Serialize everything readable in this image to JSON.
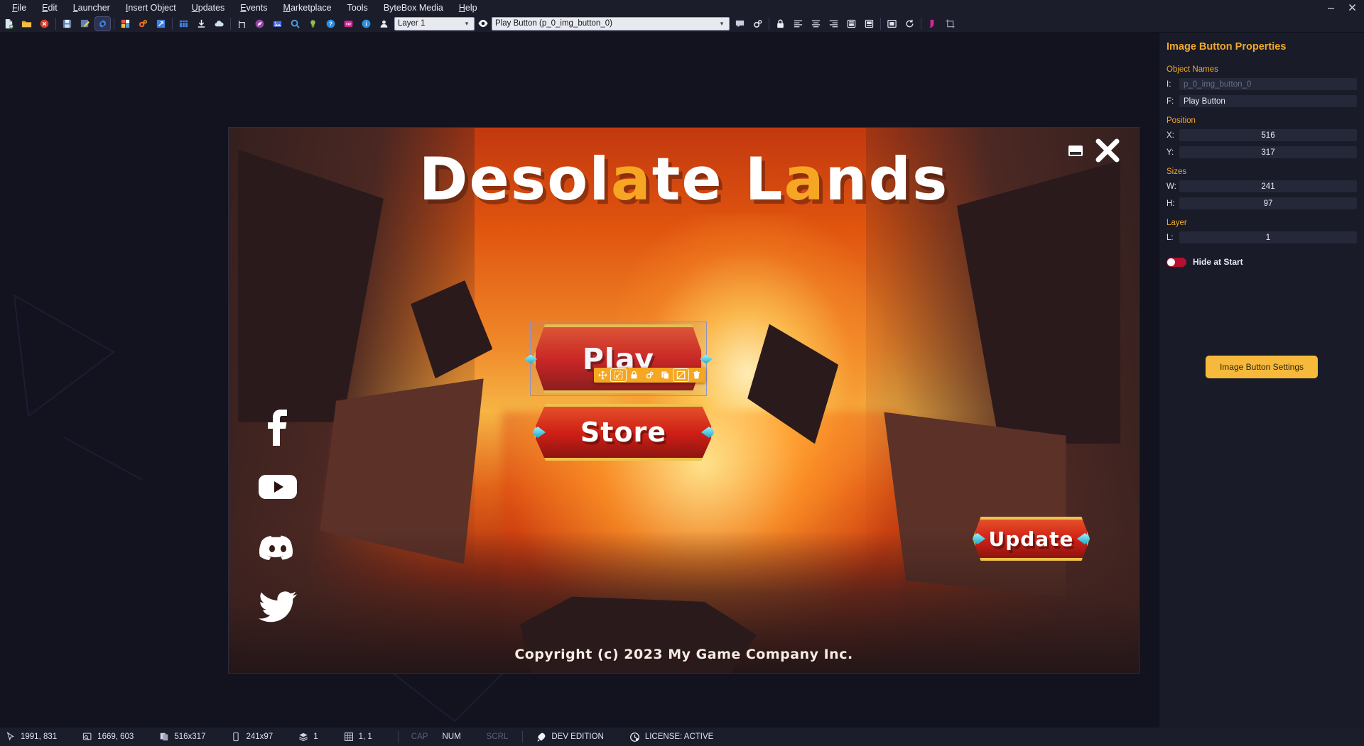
{
  "window": {
    "minimize_label": "—",
    "close_label": "✕"
  },
  "menubar": {
    "items": [
      {
        "label": "File",
        "mnemonic": "F"
      },
      {
        "label": "Edit",
        "mnemonic": "E"
      },
      {
        "label": "Launcher",
        "mnemonic": "L"
      },
      {
        "label": "Insert Object",
        "mnemonic": "I"
      },
      {
        "label": "Updates",
        "mnemonic": "U"
      },
      {
        "label": "Events",
        "mnemonic": "E"
      },
      {
        "label": "Marketplace",
        "mnemonic": "M"
      },
      {
        "label": "Tools",
        "mnemonic": ""
      },
      {
        "label": "ByteBox Media",
        "mnemonic": ""
      },
      {
        "label": "Help",
        "mnemonic": "H"
      }
    ]
  },
  "toolbar": {
    "groups": [
      [
        "new-document-icon",
        "open-folder-icon",
        "close-document-icon"
      ],
      [
        "save-project-icon",
        "export-icon",
        "project-settings-icon"
      ],
      [
        "assets-icon",
        "plugins-icon",
        "script-editor-icon"
      ],
      [
        "grid-layout-icon",
        "download-icon",
        "cloud-upload-icon"
      ],
      [
        "branch-icon",
        "publish-icon",
        "screenshot-icon",
        "preview-icon",
        "lightbulb-icon",
        "help-icon",
        "vip-icon",
        "info-icon",
        "account-icon"
      ]
    ],
    "layer_select": {
      "value": "Layer 1",
      "options": [
        "Layer 1"
      ]
    },
    "visibility_icon": "eye-icon",
    "object_select": {
      "value": "Play Button (p_0_img_button_0)",
      "options": [
        "Play Button (p_0_img_button_0)"
      ]
    },
    "right_groups": [
      [
        "comment-icon",
        "object-settings-icon"
      ],
      [
        "lock-icon",
        "align-left-icon",
        "align-center-icon",
        "align-right-icon",
        "align-top-icon",
        "align-bottom-icon"
      ],
      [
        "fit-to-screen-icon",
        "reset-icon"
      ],
      [
        "paint-icon",
        "crop-icon"
      ]
    ]
  },
  "canvas": {
    "game_title_part1": "Desol",
    "game_title_hl1": "a",
    "game_title_part2": "te L",
    "game_title_hl2": "a",
    "game_title_part3": "nds",
    "buttons": [
      {
        "id": "play",
        "label": "Play"
      },
      {
        "id": "store",
        "label": "Store"
      },
      {
        "id": "update",
        "label": "Update"
      }
    ],
    "copyright": "Copyright (c) 2023 My Game Company Inc.",
    "social": [
      {
        "name": "facebook-icon"
      },
      {
        "name": "youtube-icon"
      },
      {
        "name": "discord-icon"
      },
      {
        "name": "twitter-icon"
      }
    ],
    "corner_icons": [
      "minimize-window-icon",
      "close-window-icon"
    ],
    "floating_toolbar": [
      {
        "name": "move-icon",
        "active": false
      },
      {
        "name": "resize-icon",
        "active": true
      },
      {
        "name": "lock-object-icon",
        "active": false
      },
      {
        "name": "object-settings-gear-icon",
        "active": false
      },
      {
        "name": "duplicate-icon",
        "active": false
      },
      {
        "name": "hide-object-icon",
        "active": true
      },
      {
        "name": "delete-icon",
        "active": false
      }
    ]
  },
  "properties": {
    "title": "Image Button Properties",
    "sections": {
      "object_names": {
        "label": "Object Names",
        "id_key": "I:",
        "id_placeholder": "p_0_img_button_0",
        "friendly_key": "F:",
        "friendly_value": "Play Button"
      },
      "position": {
        "label": "Position",
        "x_key": "X:",
        "x_value": "516",
        "y_key": "Y:",
        "y_value": "317"
      },
      "sizes": {
        "label": "Sizes",
        "w_key": "W:",
        "w_value": "241",
        "h_key": "H:",
        "h_value": "97"
      },
      "layer": {
        "label": "Layer",
        "l_key": "L:",
        "l_value": "1"
      }
    },
    "hide_at_start_label": "Hide at Start",
    "hide_at_start_on": true,
    "settings_button": "Image Button Settings",
    "accent_color": "#f0a92b",
    "toggle_color": "#b4102f",
    "button_color": "#f6b93b"
  },
  "statusbar": {
    "mouse_position": "1991, 831",
    "canvas_position": "1669, 603",
    "object_position": "516x317",
    "object_size": "241x97",
    "layer": "1",
    "grid": "1, 1",
    "cap": "CAP",
    "num": "NUM",
    "scrl": "SCRL",
    "edition": "DEV EDITION",
    "license": "LICENSE: ACTIVE"
  }
}
